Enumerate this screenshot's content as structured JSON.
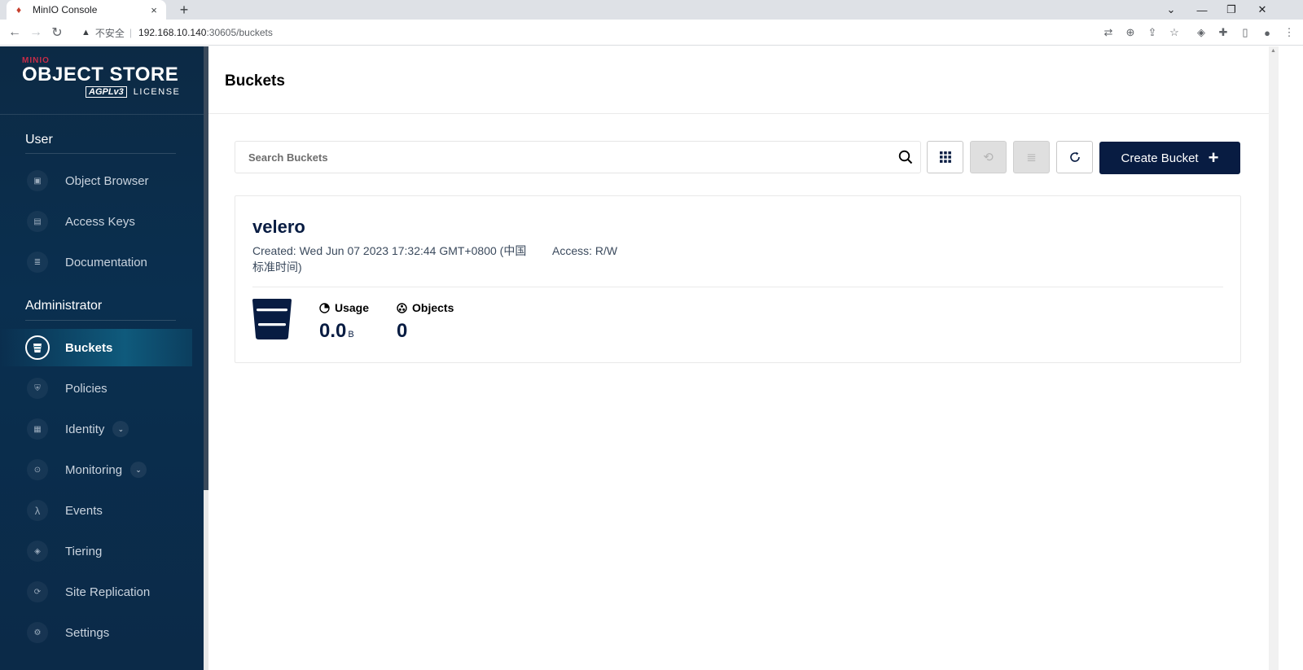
{
  "browser": {
    "tab_title": "MinIO Console",
    "tab_close": "×",
    "new_tab": "+",
    "insecure_label": "不安全",
    "address_separator": "|",
    "url_host": "192.168.10.140",
    "url_path": ":30605/buckets"
  },
  "sidebar": {
    "logo_brand": "MINIO",
    "logo_product": "OBJECT STORE",
    "logo_agpl": "AGPLv3",
    "logo_license": "LICENSE",
    "user_section": "User",
    "user_items": [
      {
        "label": "Object Browser",
        "icon": "object-browser-icon"
      },
      {
        "label": "Access Keys",
        "icon": "access-keys-icon"
      },
      {
        "label": "Documentation",
        "icon": "documentation-icon"
      }
    ],
    "admin_section": "Administrator",
    "admin_items": [
      {
        "label": "Buckets",
        "icon": "bucket-icon",
        "active": true
      },
      {
        "label": "Policies",
        "icon": "shield-icon"
      },
      {
        "label": "Identity",
        "icon": "identity-icon",
        "expandable": true
      },
      {
        "label": "Monitoring",
        "icon": "monitoring-icon",
        "expandable": true
      },
      {
        "label": "Events",
        "icon": "lambda-icon"
      },
      {
        "label": "Tiering",
        "icon": "tiering-icon"
      },
      {
        "label": "Site Replication",
        "icon": "replication-icon"
      },
      {
        "label": "Settings",
        "icon": "gear-icon"
      }
    ]
  },
  "main": {
    "page_title": "Buckets",
    "search_placeholder": "Search Buckets",
    "create_button_label": "Create Bucket",
    "create_button_icon": "+",
    "buckets": [
      {
        "name": "velero",
        "created": "Created: Wed Jun 07 2023 17:32:44 GMT+0800 (中国标准时间)",
        "access": "Access: R/W",
        "usage_label": "Usage",
        "usage_value": "0.0",
        "usage_unit": "B",
        "objects_label": "Objects",
        "objects_value": "0"
      }
    ]
  },
  "colors": {
    "sidebar_bg": "#0c2a45",
    "primary": "#081c42",
    "active_item": "#0f5a7c"
  }
}
